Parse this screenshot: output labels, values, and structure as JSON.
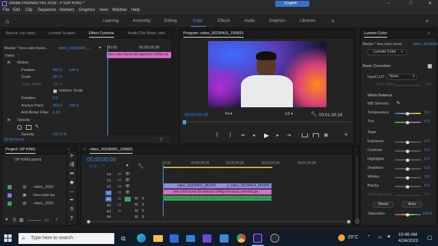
{
  "window": {
    "title": "Adobe Premiere Pro 2019 - F:\\OP KING *",
    "menu": [
      "File",
      "Edit",
      "Clip",
      "Sequence",
      "Markers",
      "Graphics",
      "View",
      "Window",
      "Help"
    ],
    "language_badge": "English",
    "controls": [
      "–",
      "□",
      "×"
    ]
  },
  "workspace_tabs": {
    "items": [
      "Learning",
      "Assembly",
      "Editing",
      "Color",
      "Effects",
      "Audio",
      "Graphics",
      "Libraries"
    ],
    "active": "Color"
  },
  "effect_controls_panel": {
    "tabs": [
      "Source: (no clips)",
      "Lumetri Scopes",
      "Effect Controls",
      "Audio Clip Mixer: vide"
    ],
    "active_tab": "Effect Controls",
    "master_label": "Master * hex-color-burst...",
    "master_clip": "video_20230401_...",
    "mini_time": "00:00",
    "mini_time_end": "00;00;59;28",
    "mini_clip": "hex-color-burst-3d-abstract-1440p-hd",
    "section_video": "Video",
    "fx_motion": "Motion",
    "position_label": "Position",
    "position_x": "960.0",
    "position_y": "540.0",
    "scale_label": "Scale",
    "scale_value": "267.0",
    "scale_width_label": "Scale Width",
    "scale_width_value": "100.0",
    "uniform_scale_label": "Uniform Scale",
    "rotation_label": "Rotation",
    "rotation_value": "0.0",
    "anchor_label": "Anchor Point",
    "anchor_x": "364.0",
    "anchor_y": "205.0",
    "antiflicker_label": "Anti-flicker Filter",
    "antiflicker_value": "0.00",
    "fx_opacity": "Opacity",
    "opacity_label": "Opacity",
    "opacity_value": "100.0 %",
    "timecode": "00;00;00;00"
  },
  "program_monitor": {
    "title": "Program: video_20230401_105831",
    "timecode": "00;00;00;00",
    "fit": "Fit",
    "resolution": "1/2",
    "duration": "00;01;30;18",
    "transport": [
      "{",
      "}",
      "⇤",
      "◂",
      "▶",
      "▸",
      "⇥"
    ]
  },
  "project_panel": {
    "title": "Project: OP KING",
    "project_file": "OP KING.prproj",
    "items": [
      {
        "name": "video_2023",
        "color": "#3aa55c"
      },
      {
        "name": "hex-color-bu",
        "color": "#8c7ad8"
      },
      {
        "name": "video_2023",
        "color": "#3aa55c"
      }
    ]
  },
  "timeline": {
    "sequence_name": "video_20230401_105831",
    "timecode": "00;00;00;00",
    "ruler": [
      "00;00",
      "00;00;29;29",
      "00;00;59;28",
      "00;01;29;29",
      "00;01;59;28"
    ],
    "video_tracks": [
      "V4",
      "V3",
      "V2",
      "V1"
    ],
    "audio_tracks": [
      "A1",
      "A2",
      "A3",
      "A4"
    ],
    "v2_clips": [
      "video_20230401_081956",
      "video_20230414_081955"
    ],
    "v1_clip": "hex-color-burst-3d-abstract-1440p-hd-music-preview.jpe"
  },
  "lumetri": {
    "title": "Lumetri Color",
    "master_label": "Master * hex-color-burst...",
    "master_clip": "video_2023040",
    "dropdown": "Lumetri Color",
    "basic_correction": "Basic Correction",
    "input_lut_label": "Input LUT",
    "input_lut_value": "None",
    "hdr_white_label": "HDR White",
    "hdr_white_value": "100",
    "white_balance_label": "White Balance",
    "wb_selector_label": "WB Selector",
    "temperature_label": "Temperature",
    "temperature_value": "0.0",
    "tint_label": "Tint",
    "tint_value": "0.0",
    "tone_label": "Tone",
    "tone_rows": [
      {
        "label": "Exposure",
        "value": "0.0"
      },
      {
        "label": "Contrast",
        "value": "0.0"
      },
      {
        "label": "Highlights",
        "value": "0.0"
      },
      {
        "label": "Shadows",
        "value": "0.0"
      },
      {
        "label": "Whites",
        "value": "0.0"
      },
      {
        "label": "Blacks",
        "value": "0.0"
      },
      {
        "label": "HDR Specular",
        "value": "0.0"
      }
    ],
    "reset_label": "Reset",
    "auto_label": "Auto",
    "saturation_label": "Saturation",
    "saturation_value": "100.0"
  },
  "taskbar": {
    "search_placeholder": "Type here to search",
    "weather": "29°C",
    "time": "10:48 AM",
    "date": "4/24/2023"
  }
}
